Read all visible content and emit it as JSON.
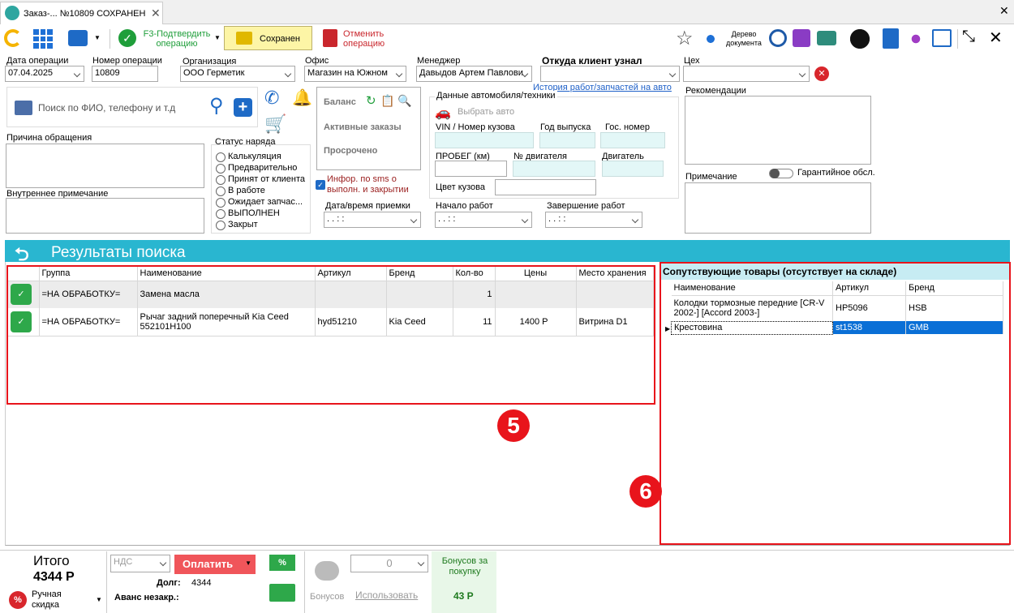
{
  "tab": {
    "title": "Заказ-... №10809 СОХРАНЕН"
  },
  "toolbar": {
    "confirm_label": "F3-Подтвердить операцию",
    "saved_label": "Сохранен",
    "cancel_label": "Отменить операцию",
    "tree_label": "Дерево документа"
  },
  "header": {
    "date_label": "Дата операции",
    "date_value": "07.04.2025",
    "number_label": "Номер операции",
    "number_value": "10809",
    "org_label": "Организация",
    "org_value": "ООО Герметик",
    "office_label": "Офис",
    "office_value": "Магазин на Южном",
    "manager_label": "Менеджер",
    "manager_value": "Давыдов Артем Павлови",
    "source_label": "Откуда клиент узнал",
    "history_link": "История работ/запчастей на авто",
    "shop_label": "Цех"
  },
  "client": {
    "search_placeholder": "Поиск по ФИО, телефону и т.д"
  },
  "balance": {
    "balance": "Баланс",
    "active": "Активные заказы",
    "overdue": "Просрочено"
  },
  "reason_label": "Причина  обращения",
  "internal_note_label": "Внутреннее примечание",
  "status": {
    "title": "Статус наряда",
    "options": [
      "Калькуляция",
      "Предварительно",
      "Принят от клиента",
      "В работе",
      "Ожидает запчас...",
      "ВЫПОЛНЕН",
      "Закрыт"
    ]
  },
  "sms_label": "Инфор. по sms о выполн. и закрытии",
  "vehicle": {
    "section": "Данные автомобиля/техники",
    "select_car": "Выбрать авто",
    "vin": "VIN / Номер кузова",
    "year": "Год выпуска",
    "plate": "Гос. номер",
    "mileage": "ПРОБЕГ (км)",
    "engine_no": "№ двигателя",
    "engine": "Двигатель",
    "color": "Цвет кузова"
  },
  "times": {
    "reception": "Дата/время приемки",
    "start": "Начало работ",
    "end": "Завершение работ",
    "placeholder": "  .  .      :  :"
  },
  "recommendations_label": "Рекомендации",
  "note_label": "Примечание",
  "warranty_label": "Гарантийное обсл.",
  "search": {
    "title": "Результаты поиска",
    "columns": [
      "Группа",
      "Наименование",
      "Артикул",
      "Бренд",
      "Кол-во",
      "Цены",
      "Место хранения"
    ],
    "rows": [
      {
        "group": "=НА ОБРАБОТКУ=",
        "name": "Замена масла",
        "article": "",
        "brand": "",
        "qty": "1",
        "price": "",
        "storage": ""
      },
      {
        "group": "=НА ОБРАБОТКУ=",
        "name": "Рычаг задний поперечный Kia Ceed 552101H100",
        "article": "hyd51210",
        "brand": "Kia Ceed",
        "qty": "11",
        "price": "1400 Р",
        "storage": "Витрина D1"
      }
    ]
  },
  "related": {
    "title": "Сопутствующие товары (отсутствует на складе)",
    "columns": [
      "Наименование",
      "Артикул",
      "Бренд"
    ],
    "rows": [
      {
        "name": "Колодки тормозные передние [CR-V 2002-] [Accord 2003-]",
        "article": "HP5096",
        "brand": "HSB"
      },
      {
        "name": "Крестовина",
        "article": "st1538",
        "brand": "GMB"
      }
    ]
  },
  "markers": {
    "m5": "5",
    "m6": "6"
  },
  "footer": {
    "total_label": "Итого",
    "total_value": "4344 Р",
    "manual_discount": "Ручная скидка",
    "vat": "НДС",
    "pay": "Оплатить",
    "debt_label": "Долг:",
    "debt_value": "4344",
    "advance_label": "Аванс незакр.:",
    "bonus_count": "0",
    "bonuses": "Бонусов",
    "use": "Использовать",
    "purchase_bonus_label": "Бонусов за покупку",
    "purchase_bonus_value": "43 Р"
  },
  "colors": {
    "accent": "#29b6d0",
    "highlight": "#0a6fd6",
    "red_marker": "#e8141b",
    "pay": "#f0555a"
  }
}
